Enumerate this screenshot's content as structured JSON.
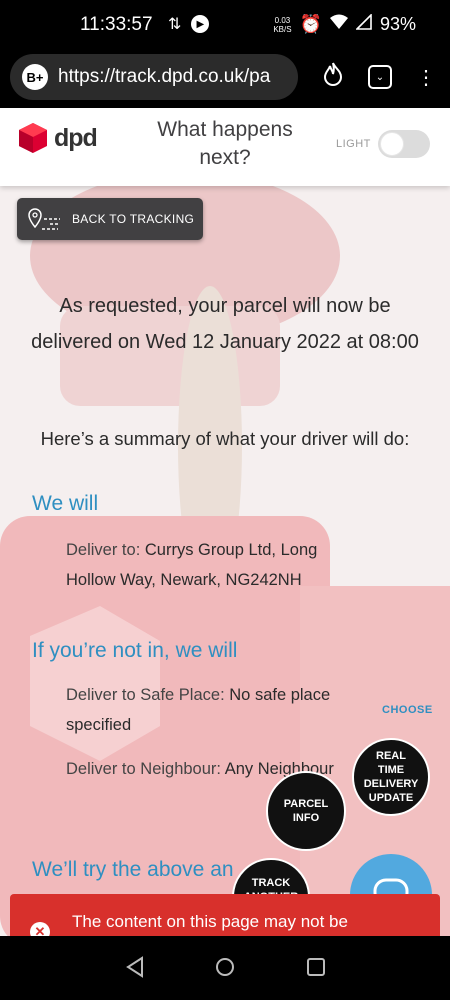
{
  "status_bar": {
    "time": "11:33:57",
    "data_rate_top": "0.03",
    "data_rate_bottom": "KB/S",
    "battery": "93%"
  },
  "browser": {
    "badge": "B+",
    "url": "https://track.dpd.co.uk/pa"
  },
  "header": {
    "logo_text": "dpd",
    "title": "What happens next?",
    "theme_label": "LIGHT"
  },
  "back_button": {
    "label": "BACK TO TRACKING"
  },
  "content": {
    "lead": "As requested, your parcel will now be delivered on Wed 12 January 2022 at 08:00",
    "summary": "Here’s a summary of what your driver will do:",
    "we_will": {
      "heading": "We will",
      "deliver_to_label": "Deliver to:",
      "deliver_to_value": "Currys Group Ltd, Long Hollow Way, Newark, NG242NH"
    },
    "not_in": {
      "heading": "If you’re not in, we will",
      "safe_place_label": "Deliver to Safe Place:",
      "safe_place_value": "No safe place specified",
      "neighbour_label": "Deliver to Neighbour:",
      "neighbour_value": "Any Neighbour"
    },
    "try_heading": "We’ll try the above an",
    "choose": "CHOOSE"
  },
  "fabs": {
    "realtime": "REAL TIME DELIVERY UPDATE",
    "parcel_info": "PARCEL INFO",
    "track_another": "TRACK ANOTHER"
  },
  "toast": {
    "text": "The content on this page may not be"
  },
  "colors": {
    "accent_blue": "#2f8fc1",
    "toast_red": "#d8302c",
    "dpd_red": "#dc0032"
  }
}
